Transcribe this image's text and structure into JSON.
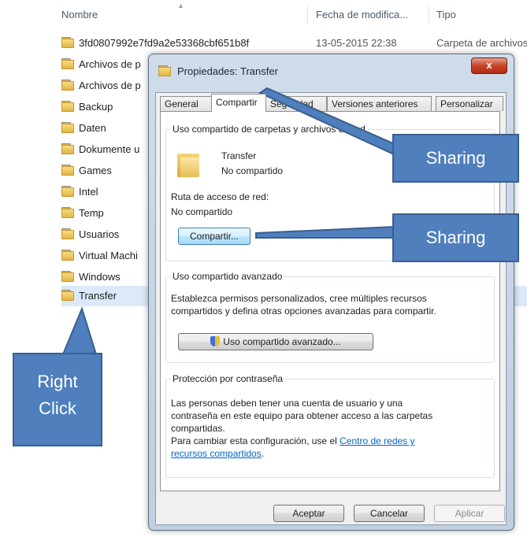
{
  "explorer": {
    "columns": {
      "name": "Nombre",
      "date": "Fecha de modifica...",
      "type": "Tipo"
    },
    "rows": [
      {
        "name": "3fd0807992e7fd9a2e53368cbf651b8f",
        "date": "13-05-2015 22:38",
        "type": "Carpeta de archivos"
      },
      {
        "name": "Archivos de p"
      },
      {
        "name": "Archivos de p"
      },
      {
        "name": "Backup"
      },
      {
        "name": "Daten"
      },
      {
        "name": "Dokumente u"
      },
      {
        "name": "Games"
      },
      {
        "name": "Intel"
      },
      {
        "name": "Temp"
      },
      {
        "name": "Usuarios"
      },
      {
        "name": "Virtual Machi"
      },
      {
        "name": "Windows"
      },
      {
        "name": "Transfer"
      }
    ]
  },
  "dialog": {
    "title": "Propiedades: Transfer",
    "close": "x",
    "tabs": [
      "General",
      "Compartir",
      "Seguridad",
      "Versiones anteriores",
      "Personalizar"
    ],
    "active_tab": "Compartir",
    "network_sharing": {
      "heading": "Uso compartido de carpetas y archivos de red",
      "folder_name": "Transfer",
      "status": "No compartido",
      "path_label": "Ruta de acceso de red:",
      "path_value": "No compartido",
      "share_button": "Compartir..."
    },
    "advanced_sharing": {
      "heading": "Uso compartido avanzado",
      "description_line1": "Establezca permisos personalizados, cree múltiples recursos",
      "description_line2": "compartidos y defina otras opciones avanzadas para compartir.",
      "button": "Uso compartido avanzado..."
    },
    "password_protection": {
      "heading": "Protección por contraseña",
      "line1": "Las personas deben tener una cuenta de usuario y una",
      "line2": "contraseña en este equipo para obtener acceso a las carpetas",
      "line3": "compartidas.",
      "line4_prefix": "Para cambiar esta configuración, use el ",
      "link_part1": "Centro de redes y",
      "link_part2": "recursos compartidos",
      "line5_suffix": "."
    },
    "buttons": {
      "ok": "Aceptar",
      "cancel": "Cancelar",
      "apply": "Aplicar"
    }
  },
  "callouts": {
    "sharing_tab": "Sharing",
    "sharing_button": "Sharing",
    "right_click_line1": "Right",
    "right_click_line2": "Click"
  },
  "colors": {
    "callout_fill": "#4f7fbd",
    "callout_border": "#3b5f8d",
    "dialog_frame": "#c5d5e6",
    "link": "#0066cc"
  }
}
